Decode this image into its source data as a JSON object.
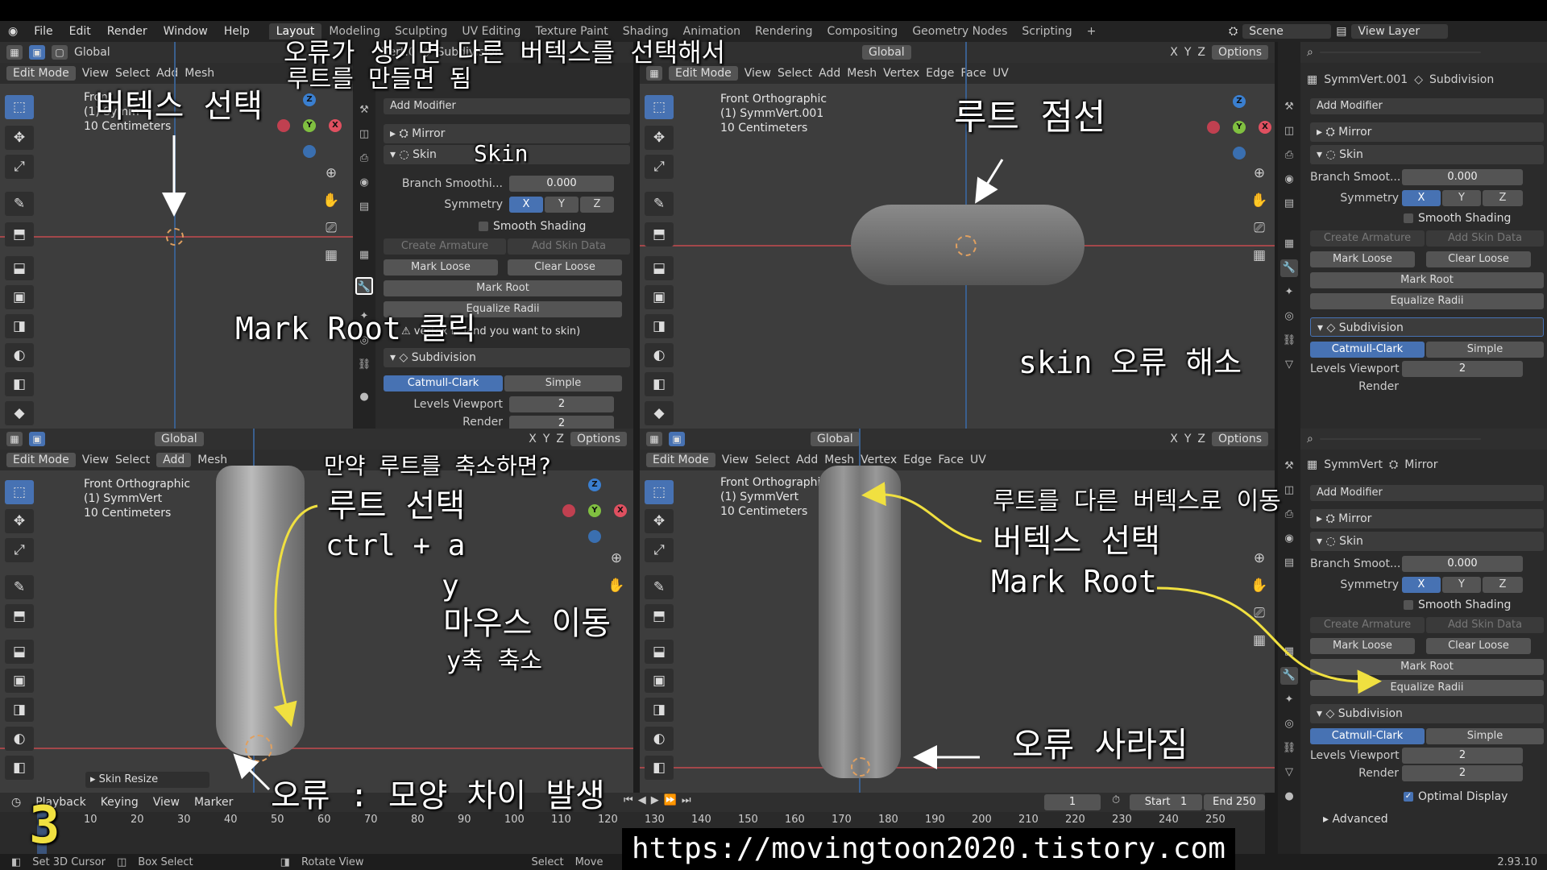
{
  "menu": {
    "items": [
      "File",
      "Edit",
      "Render",
      "Window",
      "Help"
    ]
  },
  "workspaces": [
    "Layout",
    "Modeling",
    "Sculpting",
    "UV Editing",
    "Texture Paint",
    "Shading",
    "Animation",
    "Rendering",
    "Compositing",
    "Geometry Nodes",
    "Scripting"
  ],
  "active_workspace": "Layout",
  "scene": {
    "label": "Scene",
    "view_layer": "View Layer"
  },
  "header": {
    "mode": "Edit Mode",
    "orient": "Global",
    "view": "View",
    "select": "Select",
    "add": "Add",
    "mesh": "Mesh",
    "vertex": "Vertex",
    "edge": "Edge",
    "face": "Face",
    "uv": "UV",
    "options": "Options",
    "xyz": [
      "X",
      "Y",
      "Z"
    ]
  },
  "viewports": {
    "tl": {
      "line1": "Front",
      "line2": "(1) Symm",
      "line3": "10 Centimeters"
    },
    "tr": {
      "line1": "Front Orthographic",
      "line2": "(1) SymmVert.001",
      "line3": "10 Centimeters"
    },
    "bl": {
      "line1": "Front Orthographic",
      "line2": "(1) SymmVert",
      "line3": "10 Centimeters",
      "op_panel": "Skin Resize"
    },
    "br": {
      "line1": "Front Orthographic",
      "line2": "(1) SymmVert",
      "line3": "10 Centimeters"
    }
  },
  "props_mid": {
    "object": "Vert.0",
    "subdiv_tab": "Subdivision",
    "add_modifier": "Add Modifier",
    "mirror": "Mirror",
    "skin": "Skin",
    "branch_label": "Branch Smoothi...",
    "branch_value": "0.000",
    "symmetry_label": "Symmetry",
    "smooth_shading": "Smooth Shading",
    "create_armature": "Create Armature",
    "add_skin_data": "Add Skin Data",
    "mark_loose": "Mark Loose",
    "clear_loose": "Clear Loose",
    "mark_root": "Mark Root",
    "equalize_radii": "Equalize Radii",
    "warning": "vertex f...land you want to skin)",
    "subdivision": "Subdivision",
    "catmull": "Catmull-Clark",
    "simple": "Simple",
    "levels_label": "Levels Viewport",
    "levels_value": "2",
    "render_label": "Render",
    "render_value": "2"
  },
  "props_top": {
    "object": "SymmVert.001",
    "tab": "Subdivision",
    "add_modifier": "Add Modifier",
    "mirror": "Mirror",
    "skin": "Skin",
    "branch_label": "Branch Smoot...",
    "branch_value": "0.000",
    "symmetry_label": "Symmetry",
    "smooth_shading": "Smooth Shading",
    "create_armature": "Create Armature",
    "add_skin_data": "Add Skin Data",
    "mark_loose": "Mark Loose",
    "clear_loose": "Clear Loose",
    "mark_root": "Mark Root",
    "equalize_radii": "Equalize Radii",
    "subdivision": "Subdivision",
    "catmull": "Catmull-Clark",
    "simple": "Simple",
    "levels_label": "Levels Viewport",
    "levels_value": "2",
    "render_label": "Render"
  },
  "props_bot": {
    "object": "SymmVert",
    "tab": "Mirror",
    "add_modifier": "Add Modifier",
    "mirror": "Mirror",
    "skin": "Skin",
    "branch_label": "Branch Smoot...",
    "branch_value": "0.000",
    "symmetry_label": "Symmetry",
    "smooth_shading": "Smooth Shading",
    "create_armature": "Create Armature",
    "add_skin_data": "Add Skin Data",
    "mark_loose": "Mark Loose",
    "clear_loose": "Clear Loose",
    "mark_root": "Mark Root",
    "equalize_radii": "Equalize Radii",
    "subdivision": "Subdivision",
    "catmull": "Catmull-Clark",
    "simple": "Simple",
    "levels_label": "Levels Viewport",
    "levels_value": "2",
    "render_label": "Render",
    "render_value": "2",
    "optimal_display": "Optimal Display",
    "advanced": "Advanced"
  },
  "timeline": {
    "playback": "Playback",
    "keying": "Keying",
    "view": "View",
    "marker": "Marker",
    "current_frame": "1",
    "start_label": "Start",
    "start": "1",
    "end_label": "End",
    "end": "250",
    "ticks": [
      "10",
      "20",
      "30",
      "40",
      "50",
      "60",
      "70",
      "80",
      "90",
      "100",
      "110",
      "120",
      "130",
      "140",
      "150",
      "160",
      "170",
      "180",
      "190",
      "200",
      "210",
      "220",
      "230",
      "240",
      "250"
    ]
  },
  "status": {
    "set_cursor": "Set 3D Cursor",
    "box_select": "Box Select",
    "rotate_view": "Rotate View",
    "select": "Select",
    "move": "Move",
    "version": "2.93.10"
  },
  "annotations": {
    "top_center": "오류가 생기면 다른 버텍스를 선택해서",
    "top_center2": "루트를 만들면 됨",
    "vertex_select": "버텍스 선택",
    "skin": "Skin",
    "mark_root_click": "Mark Root 클릭",
    "root_dotted": "루트 점선",
    "skin_fixed": "skin 오류 해소",
    "if_scale": "만약 루트를 축소하면?",
    "root_select": "루트 선택",
    "ctrl_a": "ctrl + a",
    "y": "y",
    "mouse_move": "마우스 이동",
    "y_scale": "y축 축소",
    "error_shape": "오류 : 모양 차이 발생",
    "move_root": "루트를 다른 버텍스로 이동",
    "vertex_select2": "버텍스 선택",
    "mark_root2": "Mark Root",
    "error_gone": "오류 사라짐",
    "step": "3",
    "url": "https://movingtoon2020.tistory.com"
  },
  "colors": {
    "accent": "#4772b3",
    "annotation": "#ffffff",
    "arrow": "#f0e040",
    "x_axis": "#a3474a",
    "z_axis": "#3a5f8e"
  }
}
